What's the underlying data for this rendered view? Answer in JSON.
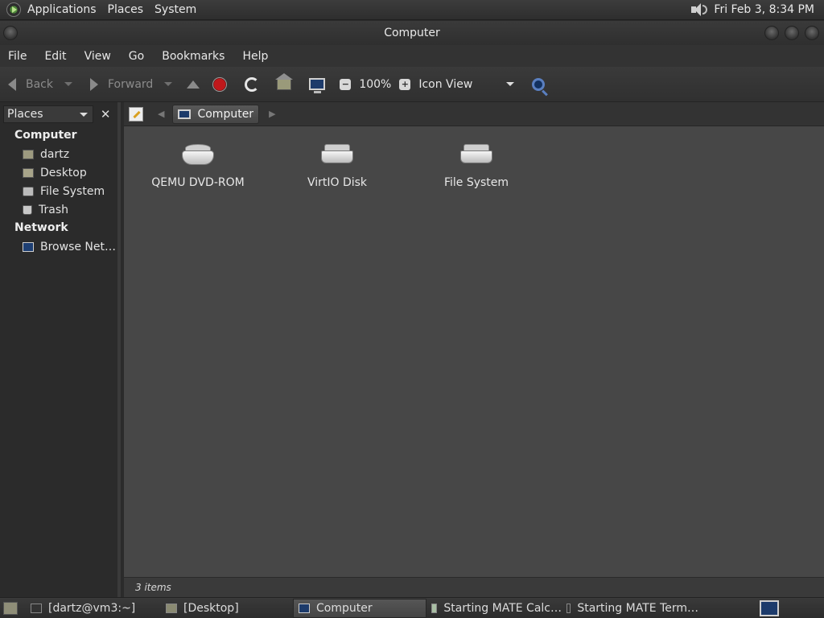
{
  "top_panel": {
    "menus": [
      "Applications",
      "Places",
      "System"
    ],
    "clock": "Fri Feb  3,  8:34 PM"
  },
  "window": {
    "title": "Computer"
  },
  "menubar": [
    "File",
    "Edit",
    "View",
    "Go",
    "Bookmarks",
    "Help"
  ],
  "toolbar": {
    "back_label": "Back",
    "forward_label": "Forward",
    "zoom_level": "100%",
    "view_mode": "Icon View"
  },
  "sidebar": {
    "selector": "Places",
    "sections": [
      {
        "title": "Computer",
        "items": [
          "dartz",
          "Desktop",
          "File System",
          "Trash"
        ]
      },
      {
        "title": "Network",
        "items": [
          "Browse Net…"
        ]
      }
    ]
  },
  "location": {
    "current": "Computer"
  },
  "files": [
    {
      "name": "QEMU DVD-ROM",
      "icon": "optical-drive-icon"
    },
    {
      "name": "VirtIO Disk",
      "icon": "hard-disk-icon"
    },
    {
      "name": "File System",
      "icon": "hard-disk-icon"
    }
  ],
  "status": "3 items",
  "taskbar": [
    {
      "label": "[dartz@vm3:~]",
      "icon": "terminal-icon",
      "active": false
    },
    {
      "label": "[Desktop]",
      "icon": "folder-icon",
      "active": false
    },
    {
      "label": "Computer",
      "icon": "computer-icon",
      "active": true
    },
    {
      "label": "Starting MATE Calc…",
      "icon": "calculator-icon",
      "active": false
    },
    {
      "label": "Starting MATE Term…",
      "icon": "terminal-icon",
      "active": false
    }
  ]
}
